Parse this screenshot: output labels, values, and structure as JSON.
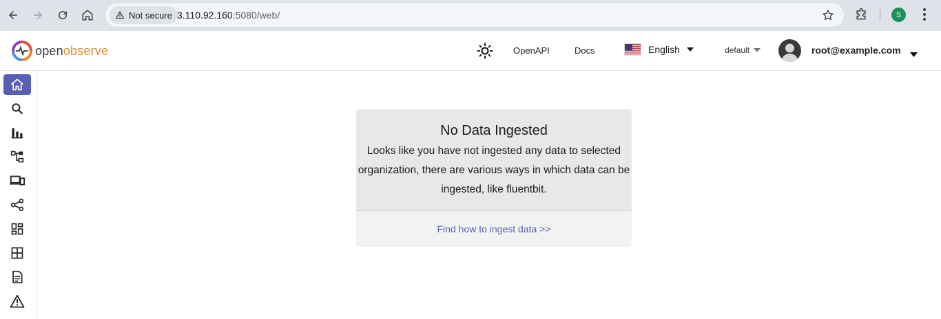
{
  "browser": {
    "security_label": "Not secure",
    "url_host": "3.110.92.160",
    "url_rest": ":5080/web/",
    "profile_initial": "S"
  },
  "header": {
    "logo_part1": "open",
    "logo_part2": "observe",
    "links": {
      "openapi": "OpenAPI",
      "docs": "Docs"
    },
    "language": "English",
    "org": "default",
    "user": "root@example.com"
  },
  "sidebar": {
    "items": [
      {
        "icon": "home-icon",
        "active": true
      },
      {
        "icon": "search-icon"
      },
      {
        "icon": "bar-chart-icon"
      },
      {
        "icon": "hierarchy-icon"
      },
      {
        "icon": "devices-icon"
      },
      {
        "icon": "share-icon"
      },
      {
        "icon": "dashboard-icon"
      },
      {
        "icon": "grid-icon"
      },
      {
        "icon": "document-icon"
      },
      {
        "icon": "alert-icon"
      }
    ]
  },
  "empty_state": {
    "title": "No Data Ingested",
    "message": "Looks like you have not ingested any data to selected organization, there are various ways in which data can be ingested, like fluentbit.",
    "link": "Find how to ingest data >>"
  },
  "colors": {
    "accent": "#5960b2",
    "link": "#5b5fb0",
    "logo_orange": "#e8872f"
  }
}
